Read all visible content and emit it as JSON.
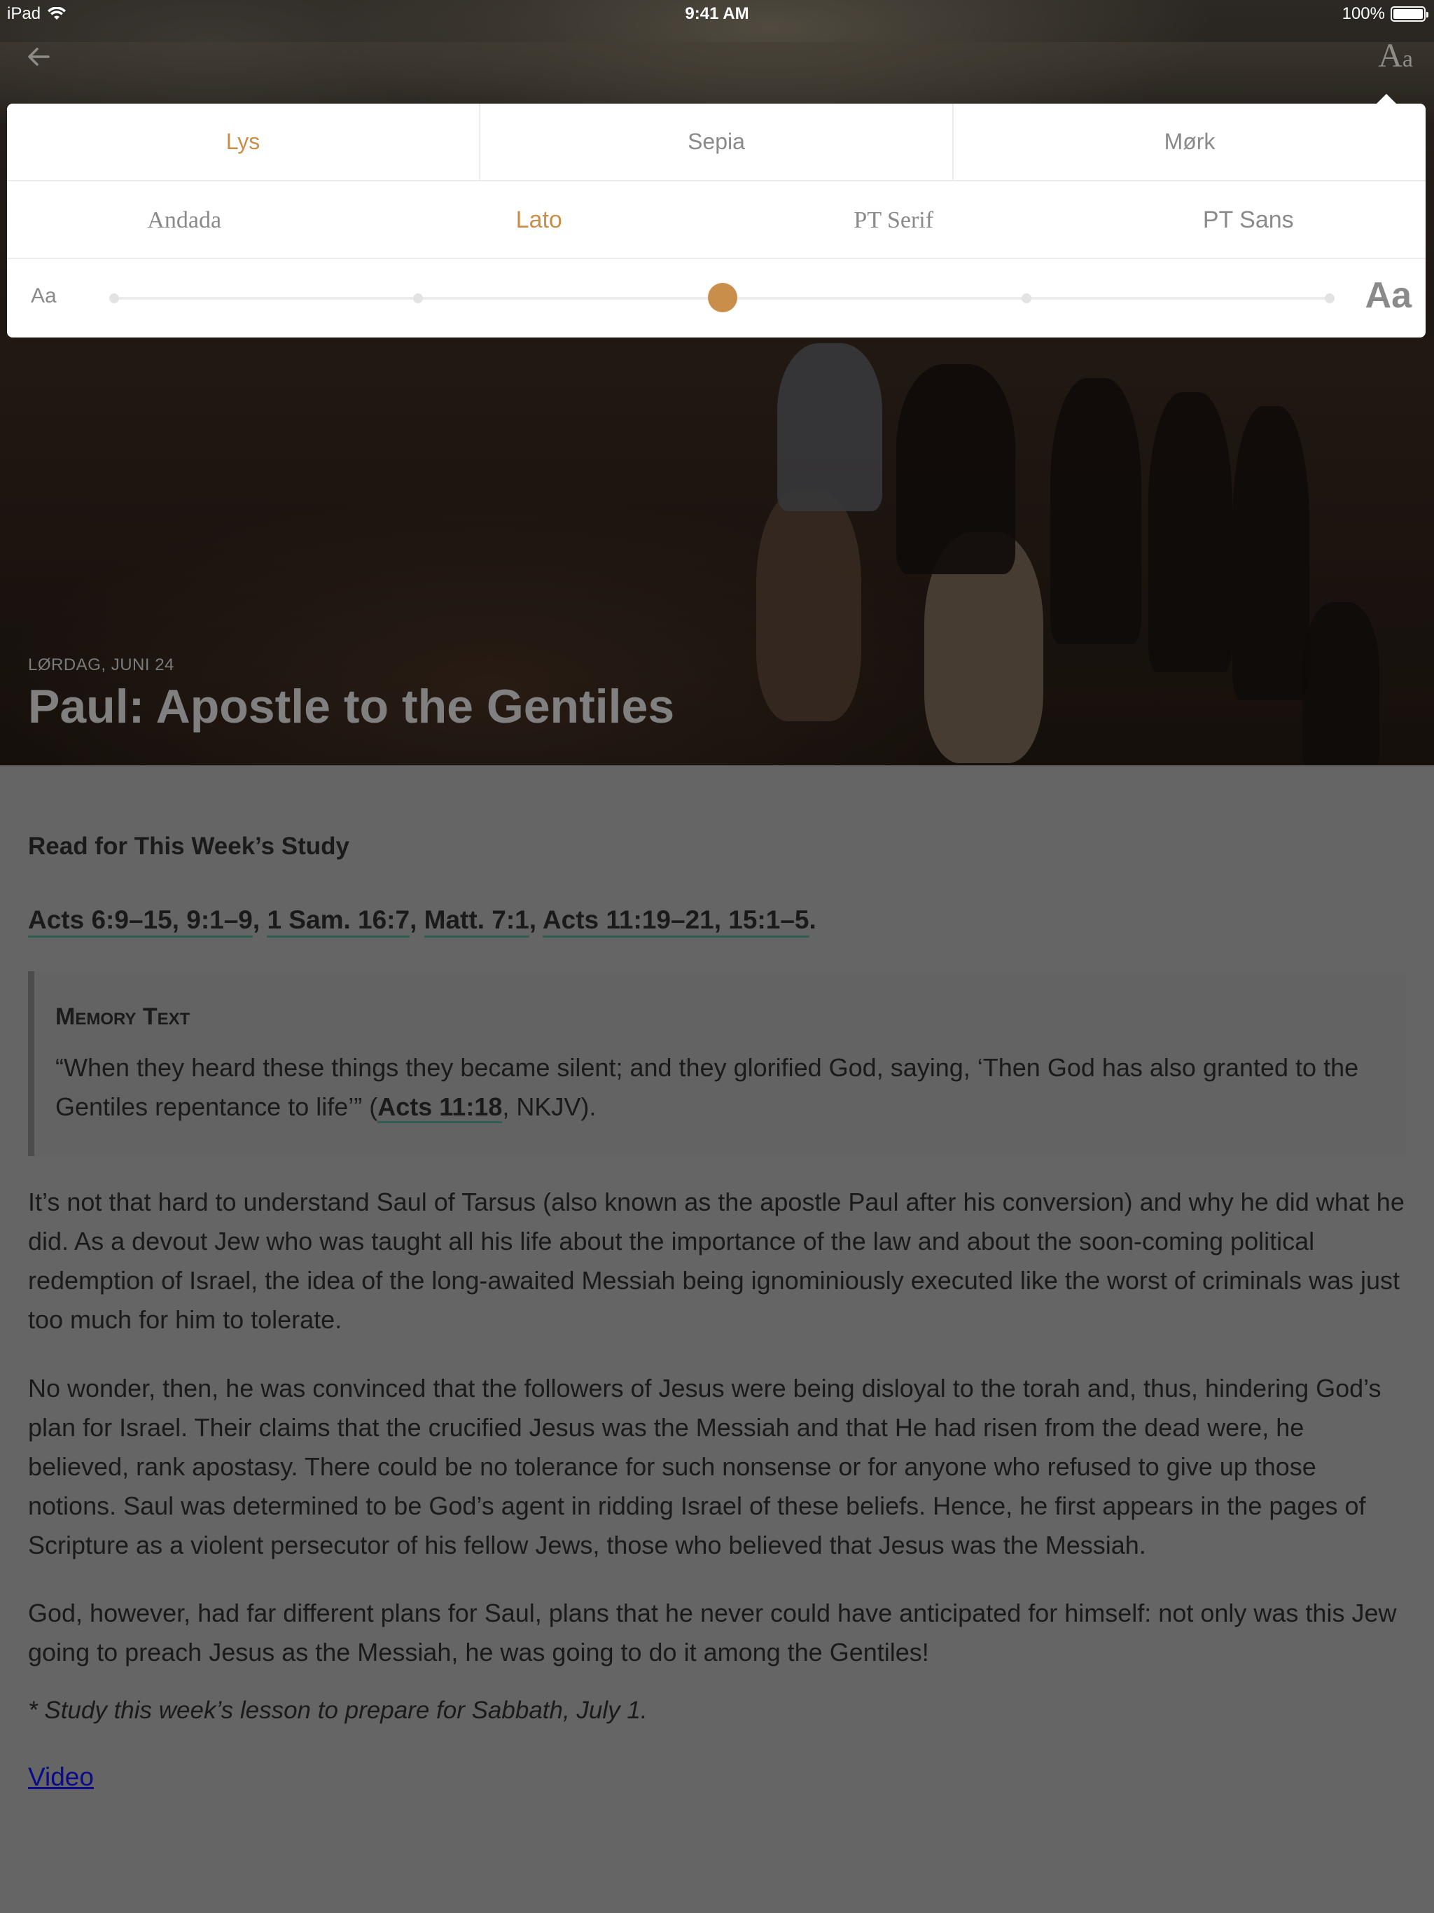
{
  "status_bar": {
    "device": "iPad",
    "time": "9:41 AM",
    "battery": "100%",
    "battery_level": 1.0
  },
  "nav": {
    "back_icon": "arrow-left-icon",
    "font_settings": {
      "big": "A",
      "small": "a"
    }
  },
  "settings": {
    "themes": [
      {
        "label": "Lys",
        "active": true
      },
      {
        "label": "Sepia",
        "active": false
      },
      {
        "label": "Mørk",
        "active": false
      }
    ],
    "fonts": [
      {
        "label": "Andada",
        "active": false
      },
      {
        "label": "Lato",
        "active": true
      },
      {
        "label": "PT Serif",
        "active": false
      },
      {
        "label": "PT Sans",
        "active": false
      }
    ],
    "size": {
      "small_label": "Aa",
      "large_label": "Aa",
      "steps": 5,
      "selected_step": 3
    },
    "accent_color": "#c98e4a"
  },
  "lesson": {
    "date": "LØRDAG, JUNI 24",
    "title": "Paul: Apostle to the Gentiles"
  },
  "article": {
    "heading": "Read for This Week’s Study",
    "refs": [
      "Acts 6:9–15, 9:1–9",
      "1 Sam. 16:7",
      "Matt. 7:1",
      "Acts 11:19–21, 15:1–5"
    ],
    "ref_sep": ", ",
    "ref_end": ".",
    "memory_title": "Memory Text",
    "memory_text_before": "“When they heard these things they became silent; and they glorified God, saying, ‘Then God has also granted to the Gentiles repentance to life’” (",
    "memory_ref": "Acts 11:18",
    "memory_text_after": ", NKJV).",
    "paragraphs": [
      "It’s not that hard to understand Saul of Tarsus (also known as the apostle Paul after his conversion) and why he did what he did. As a devout Jew who was taught all his life about the importance of the law and about the soon-coming political redemption of Israel, the idea of the long-awaited Messiah being ignominiously executed like the worst of criminals was just too much for him to tolerate.",
      "No wonder, then, he was convinced that the followers of Jesus were being disloyal to the torah and, thus, hindering God’s plan for Israel. Their claims that the crucified Jesus was the Messiah and that He had risen from the dead were, he believed, rank apostasy. There could be no tolerance for such nonsense or for anyone who refused to give up those notions. Saul was determined to be God’s agent in ridding Israel of these beliefs. Hence, he first appears in the pages of Scripture as a violent persecutor of his fellow Jews, those who believed that Jesus was the Messiah.",
      "God, however, had far different plans for Saul, plans that he never could have anticipated for himself: not only was this Jew going to preach Jesus as the Messiah, he was going to do it among the Gentiles!"
    ],
    "note": "* Study this week’s lesson to prepare for Sabbath, July 1.",
    "video_link": "Video"
  }
}
